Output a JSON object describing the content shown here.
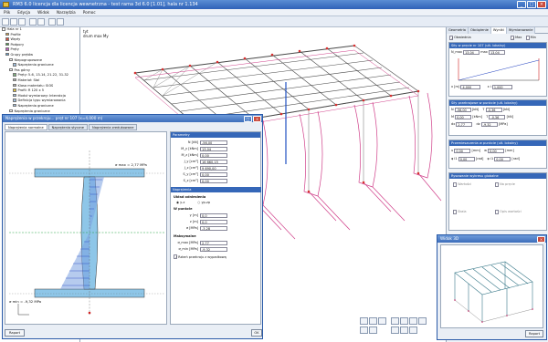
{
  "title": "RM3 6.0 licencja dla licencja wewnetrzna - test rama 3d 6.0 [1.01], hala nr 1.134",
  "menu": [
    "Plik",
    "Edycja",
    "Widok",
    "Narzędzia",
    "Pomoc"
  ],
  "tree": [
    "Hala nr 1",
    "Profile",
    "Węzły",
    "Podpory",
    "Pręty",
    "Grupy prętów",
    "Niepogrupowane",
    "Naprężenia graniczne",
    "Pas górny",
    "Pręty: 5-6, 13-14, 21-22, 31-32",
    "Materiał: Stal",
    "Klasa materiału: St3S",
    "Profil: R 120 x 5",
    "Moduł wymiarowy: Interakcja",
    "Definicja typu wymiarowania",
    "Naprężenia graniczne",
    "Naprężenia graniczne"
  ],
  "view_label": "tyt",
  "view_sublabel": "drum max My",
  "rpanel": {
    "tabs": [
      "Geometria",
      "Obciążenie",
      "Wyniki",
      "Wymiarowanie"
    ],
    "obwiednia": "Obwiednia",
    "max": "Max",
    "min": "Min",
    "sec1": "Siły w pręcie nr 107 (ult. lokalny)",
    "Nmax_lbl": "N_max",
    "Nmax": "13,04",
    "Nmax2_lbl": "max",
    "Nmax2": "13,04",
    "x_lbl": "x [m]",
    "x_val": "4,000",
    "xl_lbl": "x l",
    "xl_val": "1,000",
    "sec2": "Siły przekrojowe w punkcie (ult. lokalny)",
    "sec2_rows": [
      {
        "a": "N",
        "av": "-56,00",
        "au": "[kN]",
        "b": "T",
        "bv": "-0,36",
        "bu": "[kN]"
      },
      {
        "a": "M",
        "av": "0,00",
        "au": "[kNm]",
        "b": "T",
        "bv": "-0,36",
        "bu": "[kN]"
      },
      {
        "a": "dx",
        "av": "2,77",
        "au": "",
        "b": "dz",
        "bv": "-9,32",
        "bu": "[MPa]"
      }
    ],
    "sec3": "Przemieszczenia w punkcie (ult. lokalny)",
    "sec3_rows": [
      {
        "a": "u",
        "av": "0,00",
        "au": "[mm]",
        "b": "w",
        "bv": "0,00",
        "bu": "[mm]"
      },
      {
        "a": "φ l1",
        "av": "0,00",
        "au": "[rad]",
        "b": "φ l1",
        "bv": "0,00",
        "bu": "[rad]"
      }
    ],
    "sec4": "Rysowanie wykresu globalne",
    "sec4_items": [
      "Wartości",
      "Na pręcie",
      "Skala",
      "Opis wartości"
    ]
  },
  "win": {
    "title": "Naprężenia w przekroju... pręt nr 107 (x=4,000 m)",
    "tabs": [
      "Naprężenia normalne",
      "Naprężenia styczne",
      "Naprężenia zredukowane"
    ],
    "max_label": "σ max = 2,77 MPa",
    "min_label": "σ min = -9,32 MPa",
    "params_header": "Parametry",
    "params": [
      {
        "l": "N [kN]",
        "v": "-56,00"
      },
      {
        "l": "M_y [kNm]",
        "v": "13,04"
      },
      {
        "l": "M_z [kNm]",
        "v": "0,00"
      },
      {
        "l": "J_y [cm⁴]",
        "v": "16 660,15"
      },
      {
        "l": "J_z [cm⁴]",
        "v": "9 690,00"
      },
      {
        "l": "S_y [cm³]",
        "v": "0,00"
      },
      {
        "l": "S_z [cm³]",
        "v": "0,00"
      }
    ],
    "stress_header": "Naprężenia",
    "uklad": "Układ odniesienia",
    "opt1": "y-z",
    "opt2": "yp-zp",
    "wpunkcie": "W punkcie",
    "point": [
      {
        "l": "y [m]",
        "v": "0,0"
      },
      {
        "l": "z [m]",
        "v": "0,0"
      },
      {
        "l": "σ [MPa]",
        "v": "-3,28"
      }
    ],
    "maks": "Maksymalne",
    "maxs": [
      {
        "l": "σ_max [MPa]",
        "v": "2,77"
      },
      {
        "l": "σ_min [MPa]",
        "v": "-9,32"
      }
    ],
    "chk": "Rzkeń przekroju z wypadkową",
    "raport": "Raport",
    "ok": "OK"
  },
  "w3d": {
    "title": "Widok 3D",
    "raport": "Raport"
  }
}
